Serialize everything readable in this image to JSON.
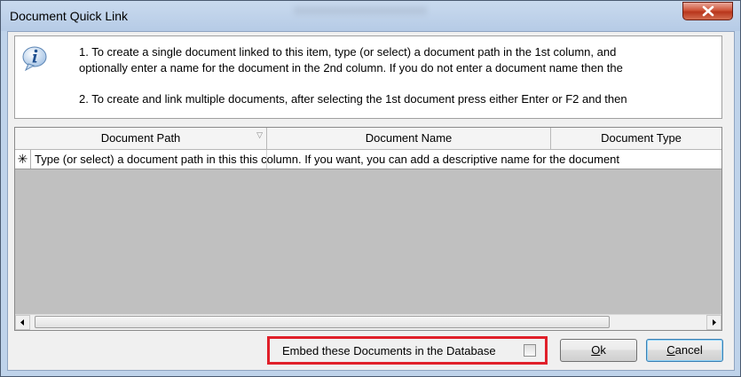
{
  "window": {
    "title": "Document Quick Link"
  },
  "info": {
    "line1": "1. To create a single document linked to this item, type (or select) a document path in the 1st column, and",
    "line2": "optionally enter a name for the document in the 2nd column. If you do not enter a document name then the",
    "line3": "2. To create and link multiple documents, after selecting the 1st document press either Enter or F2  and then"
  },
  "grid": {
    "columns": [
      {
        "label": "Document Path"
      },
      {
        "label": "Document Name"
      },
      {
        "label": "Document Type"
      }
    ],
    "new_row_indicator": "✳",
    "new_row_hint": "Type (or select) a document path in this this column. If you want, you can add a descriptive name for the document"
  },
  "embed": {
    "label": "Embed these Documents in the Database",
    "checked": false
  },
  "buttons": {
    "ok_hotkey": "O",
    "ok_rest": "k",
    "cancel_hotkey": "C",
    "cancel_rest": "ancel"
  },
  "icons": [
    "info-icon",
    "close-icon",
    "sort-icon",
    "scroll-left-icon",
    "scroll-right-icon"
  ],
  "colors": {
    "highlight_border": "#e0202a",
    "close_button": "#c8462c"
  }
}
